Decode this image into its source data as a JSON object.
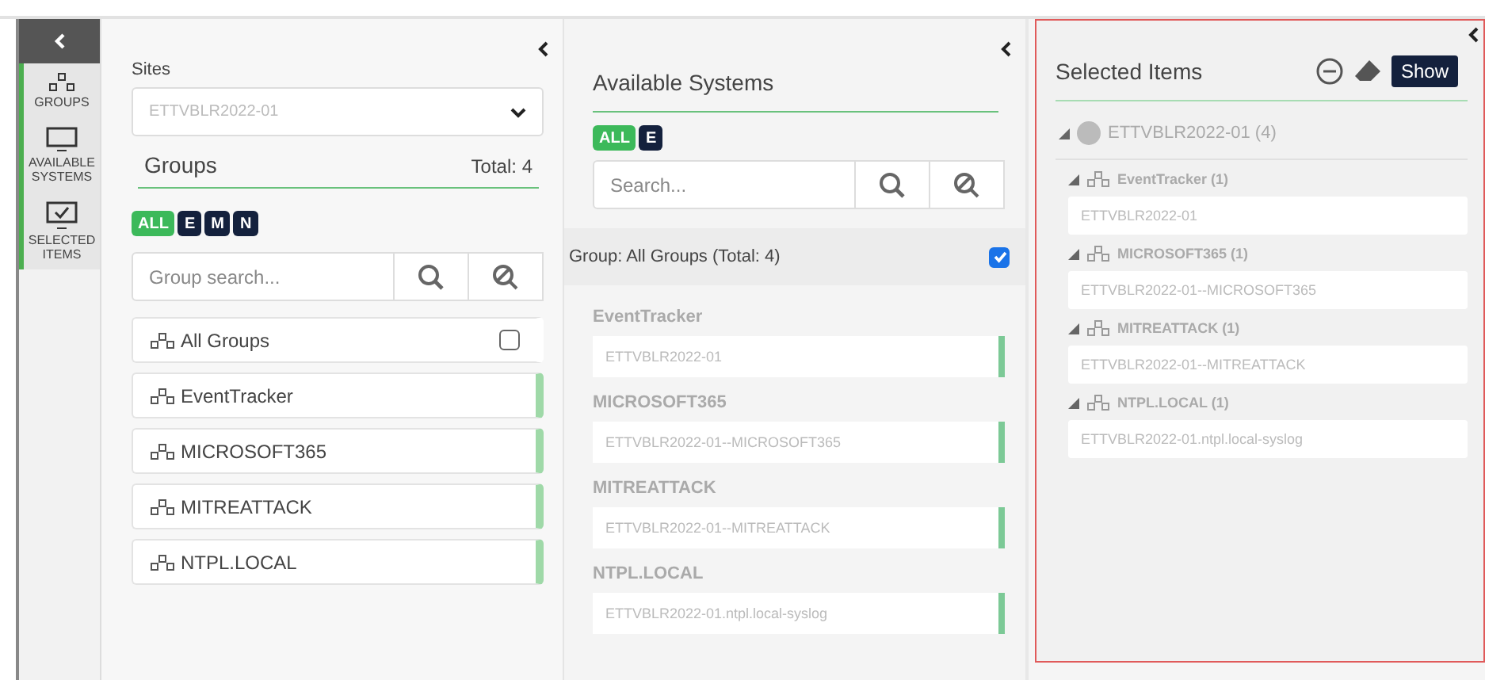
{
  "sidebar": {
    "items": [
      {
        "label": "GROUPS",
        "kind": "groups"
      },
      {
        "label": "AVAILABLE SYSTEMS",
        "kind": "systems"
      },
      {
        "label": "SELECTED ITEMS",
        "kind": "selected"
      }
    ]
  },
  "groups_panel": {
    "sites_label": "Sites",
    "site_value": "ETTVBLR2022-01",
    "title": "Groups",
    "total": "Total: 4",
    "filters": [
      {
        "label": "ALL",
        "selected": true
      },
      {
        "label": "E",
        "selected": false
      },
      {
        "label": "M",
        "selected": false
      },
      {
        "label": "N",
        "selected": false
      }
    ],
    "search_placeholder": "Group search...",
    "items": [
      {
        "label": "All Groups",
        "kind": "all",
        "checked": false
      },
      {
        "label": "EventTracker",
        "kind": "group",
        "selected": true
      },
      {
        "label": "MICROSOFT365",
        "kind": "group",
        "selected": true
      },
      {
        "label": "MITREATTACK",
        "kind": "group",
        "selected": true
      },
      {
        "label": "NTPL.LOCAL",
        "kind": "group",
        "selected": true
      }
    ]
  },
  "systems_panel": {
    "title": "Available Systems",
    "filters": [
      {
        "label": "ALL",
        "selected": true
      },
      {
        "label": "E",
        "selected": false
      }
    ],
    "search_placeholder": "Search...",
    "group_header": "Group: All Groups (Total: 4)",
    "group_checked": true,
    "sections": [
      {
        "title": "EventTracker",
        "systems": [
          {
            "label": "ETTVBLR2022-01",
            "selected": true
          }
        ]
      },
      {
        "title": "MICROSOFT365",
        "systems": [
          {
            "label": "ETTVBLR2022-01--MICROSOFT365",
            "selected": true
          }
        ]
      },
      {
        "title": "MITREATTACK",
        "systems": [
          {
            "label": "ETTVBLR2022-01--MITREATTACK",
            "selected": true
          }
        ]
      },
      {
        "title": "NTPL.LOCAL",
        "systems": [
          {
            "label": "ETTVBLR2022-01.ntpl.local-syslog",
            "selected": true
          }
        ]
      }
    ]
  },
  "selected_panel": {
    "title": "Selected Items",
    "button": "Show",
    "tree": [
      {
        "label": "ETTVBLR2022-01 (4)",
        "children": [
          {
            "label": "EventTracker (1)",
            "children": [
              {
                "label": "ETTVBLR2022-01"
              }
            ]
          },
          {
            "label": "MICROSOFT365 (1)",
            "children": [
              {
                "label": "ETTVBLR2022-01--MICROSOFT365"
              }
            ]
          },
          {
            "label": "MITREATTACK (1)",
            "children": [
              {
                "label": "ETTVBLR2022-01--MITREATTACK"
              }
            ]
          },
          {
            "label": "NTPL.LOCAL (1)",
            "children": [
              {
                "label": "ETTVBLR2022-01.ntpl.local-syslog"
              }
            ]
          }
        ]
      }
    ]
  }
}
